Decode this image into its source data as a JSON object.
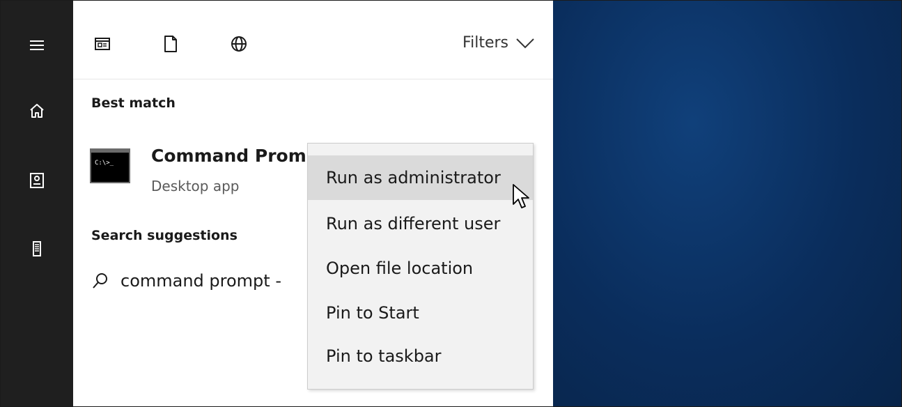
{
  "sidebar": {
    "items": [
      {
        "icon": "hamburger-menu-icon"
      },
      {
        "icon": "home-icon"
      },
      {
        "icon": "notebook-icon"
      },
      {
        "icon": "device-tower-icon"
      }
    ]
  },
  "toolbar": {
    "icons": [
      "apps-filter-icon",
      "documents-filter-icon",
      "web-filter-icon"
    ],
    "filters_label": "Filters"
  },
  "best_match": {
    "heading": "Best match",
    "app_name": "Command Prom",
    "app_type": "Desktop app",
    "icon_text": "C:\\>_"
  },
  "search_suggestions": {
    "heading": "Search suggestions",
    "item": "command prompt -"
  },
  "context_menu": {
    "items": [
      {
        "label": "Run as administrator",
        "hovered": true
      },
      {
        "label": "Run as different user"
      },
      {
        "label": "Open file location"
      },
      {
        "label": "Pin to Start"
      },
      {
        "label": "Pin to taskbar"
      }
    ]
  },
  "colors": {
    "sidebar": "#1f1f1f",
    "panel": "#ffffff",
    "menu": "#f2f2f2",
    "menu_hover": "#dadada",
    "desktop": "#0b2a52"
  }
}
